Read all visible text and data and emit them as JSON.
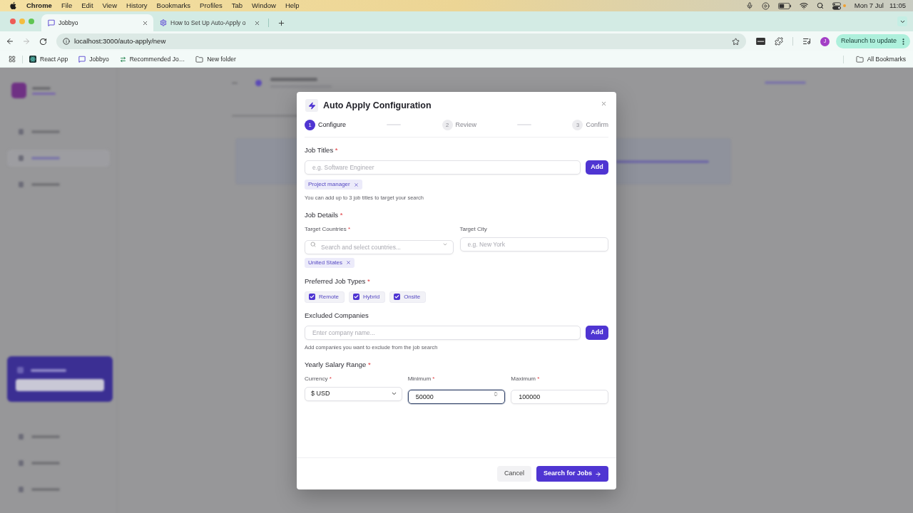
{
  "menu_bar": {
    "app": "Chrome",
    "menus": [
      "File",
      "Edit",
      "View",
      "History",
      "Bookmarks",
      "Profiles",
      "Tab",
      "Window",
      "Help"
    ],
    "date": "Mon 7 Jul",
    "time": "11:05"
  },
  "tabs": [
    {
      "title": "Jobbyo",
      "selected": true
    },
    {
      "title": "How to Set Up Auto-Apply o",
      "selected": false
    }
  ],
  "toolbar": {
    "url": "localhost:3000/auto-apply/new",
    "back_disabled": false,
    "forward_disabled": true,
    "profile_initial": "J",
    "relaunch_button": "Relaunch to update"
  },
  "bookmarks": {
    "items": [
      "React App",
      "Jobbyo",
      "Recommended Jo…",
      "New folder"
    ],
    "all_bookmarks": "All Bookmarks"
  },
  "background_sidebar": {
    "top_nav": [
      {
        "selected": false
      },
      {
        "selected": true
      },
      {
        "selected": false
      }
    ],
    "bottom_nav": [
      {
        "selected": false
      },
      {
        "selected": false
      },
      {
        "selected": false
      }
    ]
  },
  "dialog": {
    "title": "Auto Apply Configuration",
    "steps": [
      {
        "number": "1",
        "label": "Configure",
        "selected": true
      },
      {
        "number": "2",
        "label": "Review",
        "selected": false
      },
      {
        "number": "3",
        "label": "Confirm",
        "selected": false
      }
    ],
    "job_titles": {
      "label": "Job Titles",
      "required_mark": "*",
      "placeholder": "e.g. Software Engineer",
      "add_button": "Add",
      "chips": [
        "Project manager"
      ],
      "hint": "You can add up to 3 job titles to target your search"
    },
    "job_details": {
      "label": "Job Details",
      "required_mark": "*",
      "countries": {
        "label": "Target Countries",
        "required_mark": "*",
        "placeholder": "Search and select countries...",
        "chips": [
          "United States"
        ]
      },
      "city": {
        "label": "Target City",
        "placeholder": "e.g. New York"
      }
    },
    "job_types": {
      "label": "Preferred Job Types",
      "required_mark": "*",
      "options": [
        {
          "label": "Remote",
          "checked": true
        },
        {
          "label": "Hybrid",
          "checked": true
        },
        {
          "label": "Onsite",
          "checked": true
        }
      ]
    },
    "excluded_companies": {
      "label": "Excluded Companies",
      "placeholder": "Enter company name...",
      "add_button": "Add",
      "hint": "Add companies you want to exclude from the job search"
    },
    "salary": {
      "label": "Yearly Salary Range",
      "required_mark": "*",
      "currency": {
        "label": "Currency",
        "required_mark": "*",
        "value": "$ USD"
      },
      "minimum": {
        "label": "Minimum",
        "required_mark": "*",
        "value": "50000",
        "focused": true
      },
      "maximum": {
        "label": "Maximum",
        "required_mark": "*",
        "value": "100000",
        "focused": false
      }
    },
    "buttons": {
      "cancel": "Cancel",
      "submit": "Search for Jobs"
    }
  }
}
